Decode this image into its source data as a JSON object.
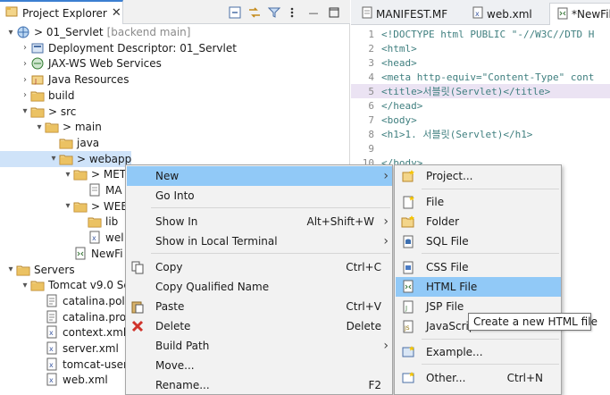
{
  "explorer": {
    "tab_label": "Project Explorer",
    "close_glyph": "✕",
    "toolbar_icons": [
      "collapse-all-icon",
      "link-with-editor-icon",
      "filter-icon",
      "view-menu-icon"
    ],
    "minimize_glyph": "—"
  },
  "tree": [
    {
      "label": "> 01_Servlet",
      "extra": "[backend main]",
      "icon": "web-project-icon",
      "arrow": "▾"
    },
    {
      "label": "Deployment Descriptor: 01_Servlet",
      "icon": "deployment-descriptor-icon",
      "arrow": "›"
    },
    {
      "label": "JAX-WS Web Services",
      "icon": "web-services-icon",
      "arrow": "›"
    },
    {
      "label": "Java Resources",
      "icon": "java-resources-icon",
      "arrow": "›"
    },
    {
      "label": "build",
      "icon": "folder-icon",
      "arrow": "›"
    },
    {
      "label": "> src",
      "icon": "folder-icon",
      "arrow": "▾"
    },
    {
      "label": "> main",
      "icon": "folder-icon",
      "arrow": "▾"
    },
    {
      "label": "java",
      "icon": "folder-icon",
      "arrow": ""
    },
    {
      "label": "> webapp",
      "icon": "folder-icon",
      "arrow": "▾"
    },
    {
      "label": "> MET",
      "icon": "folder-icon",
      "arrow": "▾"
    },
    {
      "label": "MA",
      "icon": "manifest-file-icon",
      "arrow": ""
    },
    {
      "label": "> WEB",
      "icon": "folder-icon",
      "arrow": "▾"
    },
    {
      "label": "lib",
      "icon": "folder-icon",
      "arrow": ""
    },
    {
      "label": "wel",
      "icon": "xml-file-icon",
      "arrow": ""
    },
    {
      "label": "NewFi",
      "icon": "html-file-icon",
      "arrow": ""
    },
    {
      "label": "Servers",
      "icon": "folder-icon",
      "arrow": "▾"
    },
    {
      "label": "Tomcat v9.0 Se",
      "icon": "folder-icon",
      "arrow": "▾"
    },
    {
      "label": "catalina.poli",
      "icon": "policy-file-icon",
      "arrow": ""
    },
    {
      "label": "catalina.prop",
      "icon": "properties-file-icon",
      "arrow": ""
    },
    {
      "label": "context.xml",
      "icon": "xml-file-icon",
      "arrow": ""
    },
    {
      "label": "server.xml",
      "icon": "xml-file-icon",
      "arrow": ""
    },
    {
      "label": "tomcat-user",
      "icon": "xml-file-icon",
      "arrow": ""
    },
    {
      "label": "web.xml",
      "icon": "xml-file-icon",
      "arrow": ""
    }
  ],
  "editor": {
    "tabs": [
      {
        "label": "MANIFEST.MF",
        "icon": "manifest-file-icon"
      },
      {
        "label": "web.xml",
        "icon": "xml-file-icon"
      },
      {
        "label": "*NewFil",
        "icon": "html-file-icon"
      }
    ],
    "lines": [
      {
        "n": "1",
        "text": "<!DOCTYPE html PUBLIC \"-//W3C//DTD H"
      },
      {
        "n": "2",
        "text": "<html>"
      },
      {
        "n": "3",
        "text": "<head>"
      },
      {
        "n": "4",
        "text": "<meta http-equiv=\"Content-Type\" cont"
      },
      {
        "n": "5",
        "text": "<title>서블릿(Servlet)</title>"
      },
      {
        "n": "6",
        "text": "</head>"
      },
      {
        "n": "7",
        "text": "<body>"
      },
      {
        "n": "8",
        "text": "    <h1>1. 서블릿(Servlet)</h1>"
      },
      {
        "n": "9",
        "text": ""
      },
      {
        "n": "10",
        "text": "</body>"
      }
    ]
  },
  "context_menu": {
    "items": [
      {
        "label": "New",
        "shortcut": "",
        "submenu": true,
        "icon": ""
      },
      {
        "label": "Go Into",
        "shortcut": "",
        "submenu": false,
        "icon": ""
      },
      {
        "label": "Show In",
        "shortcut": "Alt+Shift+W",
        "submenu": true,
        "icon": ""
      },
      {
        "label": "Show in Local Terminal",
        "shortcut": "",
        "submenu": true,
        "icon": ""
      },
      {
        "label": "Copy",
        "shortcut": "Ctrl+C",
        "submenu": false,
        "icon": "copy-icon"
      },
      {
        "label": "Copy Qualified Name",
        "shortcut": "",
        "submenu": false,
        "icon": ""
      },
      {
        "label": "Paste",
        "shortcut": "Ctrl+V",
        "submenu": false,
        "icon": "paste-icon"
      },
      {
        "label": "Delete",
        "shortcut": "Delete",
        "submenu": false,
        "icon": "delete-icon"
      },
      {
        "label": "Build Path",
        "shortcut": "",
        "submenu": true,
        "icon": ""
      },
      {
        "label": "Move...",
        "shortcut": "",
        "submenu": false,
        "icon": ""
      },
      {
        "label": "Rename...",
        "shortcut": "F2",
        "submenu": false,
        "icon": ""
      }
    ]
  },
  "submenu": {
    "items": [
      {
        "label": "Project...",
        "shortcut": "",
        "icon": "new-project-icon"
      },
      {
        "label": "File",
        "shortcut": "",
        "icon": "new-file-icon"
      },
      {
        "label": "Folder",
        "shortcut": "",
        "icon": "new-folder-icon"
      },
      {
        "label": "SQL File",
        "shortcut": "",
        "icon": "sql-file-icon"
      },
      {
        "label": "CSS File",
        "shortcut": "",
        "icon": "css-file-icon"
      },
      {
        "label": "HTML File",
        "shortcut": "",
        "icon": "html-file-icon"
      },
      {
        "label": "JSP File",
        "shortcut": "",
        "icon": "jsp-file-icon"
      },
      {
        "label": "JavaScrip",
        "shortcut": "",
        "icon": "javascript-file-icon"
      },
      {
        "label": "Example...",
        "shortcut": "",
        "icon": "example-icon"
      },
      {
        "label": "Other...",
        "shortcut": "Ctrl+N",
        "icon": "other-wizard-icon"
      }
    ]
  },
  "tooltip": "Create a new HTML file",
  "colors": {
    "selection": "#91c9f7",
    "tab_accent": "#3c7fd1",
    "folder": "#e6b54a",
    "tag": "#3f7f7f",
    "string": "#2a00ff",
    "attribute": "#7f007f"
  }
}
